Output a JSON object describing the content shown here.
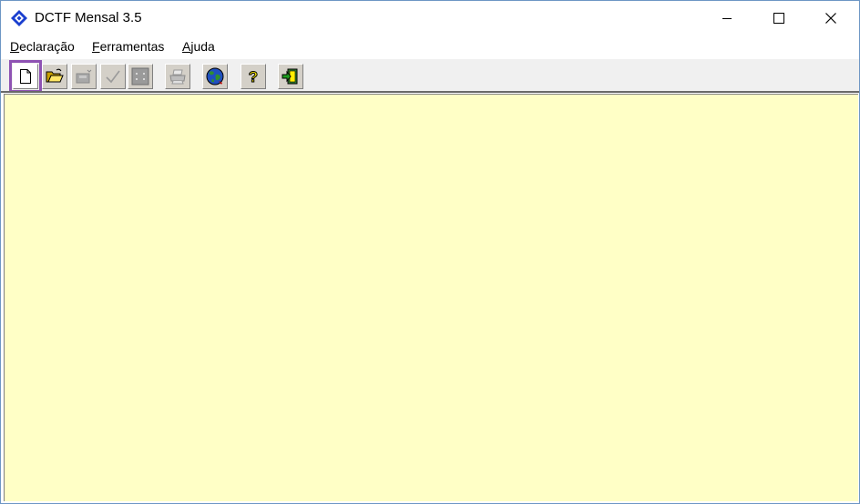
{
  "window": {
    "title": "DCTF Mensal 3.5",
    "minimize_symbol": "—",
    "maximize_symbol": "☐",
    "close_symbol": "✕"
  },
  "menu": {
    "items": [
      {
        "accel": "D",
        "rest": "eclaração"
      },
      {
        "accel": "F",
        "rest": "erramentas"
      },
      {
        "accel": "A",
        "rest": "juda"
      }
    ]
  },
  "toolbar": {
    "buttons": [
      {
        "icon": "new-document-icon"
      },
      {
        "icon": "open-folder-icon"
      },
      {
        "icon": "save-icon",
        "state": "disabled"
      },
      {
        "icon": "check-icon",
        "state": "disabled"
      },
      {
        "icon": "calculator-icon",
        "state": "disabled"
      },
      {
        "icon": "printer-icon",
        "state": "disabled"
      },
      {
        "icon": "globe-icon"
      },
      {
        "icon": "help-icon"
      },
      {
        "icon": "exit-icon"
      }
    ]
  },
  "colors": {
    "workspace": "#ffffc6",
    "highlight": "#8e52b3",
    "app_icon": "#1a3fcf"
  }
}
